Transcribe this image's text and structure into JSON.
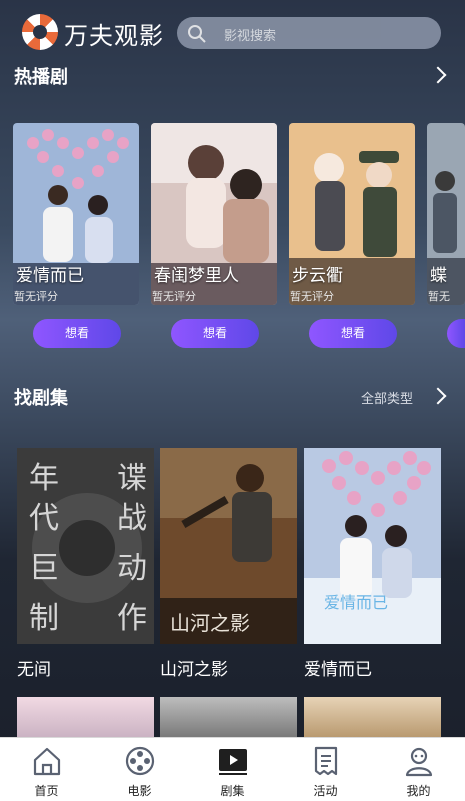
{
  "app": {
    "name": "万夫观影"
  },
  "search": {
    "placeholder": "影视搜索"
  },
  "hot": {
    "title": "热播剧",
    "items": [
      {
        "title": "爱情而已",
        "rating": "暂无评分",
        "button": "想看"
      },
      {
        "title": "春闺梦里人",
        "rating": "暂无评分",
        "button": "想看"
      },
      {
        "title": "步云衢",
        "rating": "暂无评分",
        "button": "想看"
      },
      {
        "title": "蝶",
        "rating": "暂无",
        "button": ""
      }
    ]
  },
  "find": {
    "title": "找剧集",
    "more": "全部类型",
    "items": [
      {
        "title": "无间",
        "poster_text": "年代巨制 谍战动作"
      },
      {
        "title": "山河之影",
        "poster_text": "山河之影"
      },
      {
        "title": "爱情而已",
        "poster_text": "爱情而已"
      }
    ]
  },
  "tabs": [
    {
      "label": "首页",
      "icon": "home-icon"
    },
    {
      "label": "电影",
      "icon": "film-reel-icon"
    },
    {
      "label": "剧集",
      "icon": "play-icon"
    },
    {
      "label": "活动",
      "icon": "document-icon"
    },
    {
      "label": "我的",
      "icon": "profile-icon"
    }
  ],
  "colors": {
    "accent": "#7a4ff5",
    "tabbar_bg": "#ffffff"
  }
}
